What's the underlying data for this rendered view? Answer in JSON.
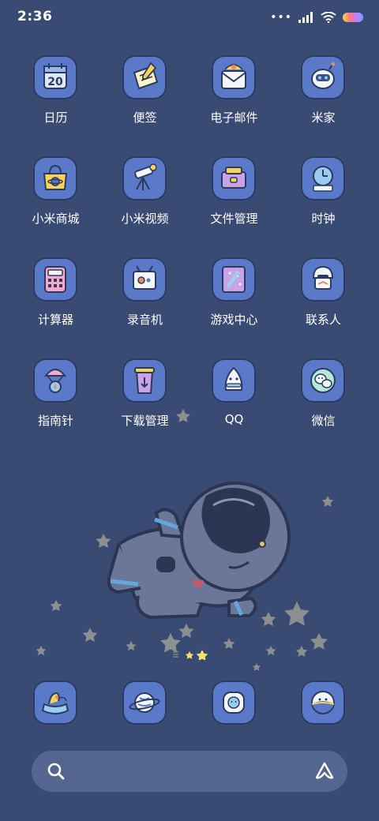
{
  "status_bar": {
    "time": "2:36",
    "signal_dots": "•••",
    "icons": [
      "signal-icon",
      "wifi-icon",
      "battery-icon"
    ]
  },
  "apps": {
    "row1": [
      {
        "label": "日历",
        "icon": "calendar-icon",
        "icon_text": "20"
      },
      {
        "label": "便签",
        "icon": "notes-icon"
      },
      {
        "label": "电子邮件",
        "icon": "email-icon"
      },
      {
        "label": "米家",
        "icon": "mijia-icon"
      }
    ],
    "row2": [
      {
        "label": "小米商城",
        "icon": "mi-store-icon"
      },
      {
        "label": "小米视频",
        "icon": "mi-video-icon"
      },
      {
        "label": "文件管理",
        "icon": "file-manager-icon"
      },
      {
        "label": "时钟",
        "icon": "clock-icon"
      }
    ],
    "row3": [
      {
        "label": "计算器",
        "icon": "calculator-icon"
      },
      {
        "label": "录音机",
        "icon": "recorder-icon"
      },
      {
        "label": "游戏中心",
        "icon": "game-center-icon"
      },
      {
        "label": "联系人",
        "icon": "contacts-icon"
      }
    ],
    "row4": [
      {
        "label": "指南针",
        "icon": "compass-icon"
      },
      {
        "label": "下载管理",
        "icon": "download-manager-icon"
      },
      {
        "label": "QQ",
        "icon": "qq-icon"
      },
      {
        "label": "微信",
        "icon": "wechat-icon"
      }
    ]
  },
  "page_indicator": {
    "pages": 3,
    "current": 3
  },
  "dock": [
    {
      "icon": "phone-icon"
    },
    {
      "icon": "browser-planet-icon"
    },
    {
      "icon": "messages-icon"
    },
    {
      "icon": "camera-planet-icon"
    }
  ],
  "colors": {
    "background": "#394a73",
    "icon_tile": "#5a79c9",
    "search_bar": "#54668f",
    "star": "#8b8f8f",
    "indicator_active": "#f7e36b"
  },
  "search": {
    "icon": "search-icon",
    "assistant_icon": "assistant-icon"
  }
}
